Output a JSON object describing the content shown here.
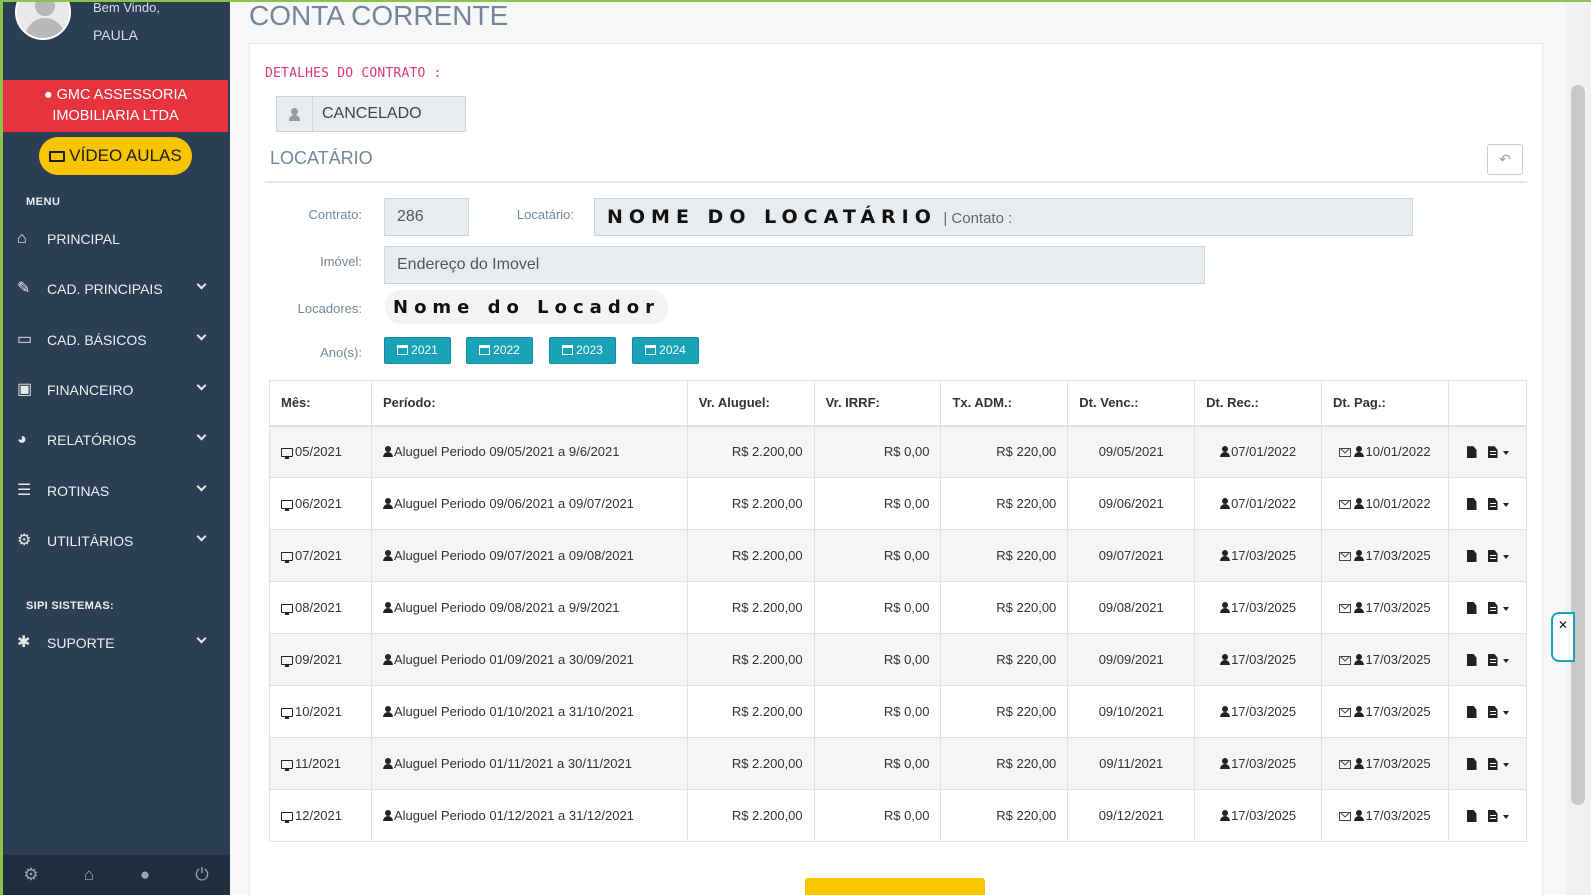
{
  "sidebar": {
    "welcome": "Bem Vindo,",
    "username": "PAULA",
    "company": "GMC ASSESSORIA IMOBILIARIA LTDA",
    "video_label": "VÍDEO AULAS",
    "menu_title": "MENU",
    "items": [
      {
        "label": "PRINCIPAL",
        "icon": "home-icon"
      },
      {
        "label": "CAD. PRINCIPAIS",
        "icon": "edit-icon"
      },
      {
        "label": "CAD. BÁSICOS",
        "icon": "folder-icon"
      },
      {
        "label": "FINANCEIRO",
        "icon": "money-icon"
      },
      {
        "label": "RELATÓRIOS",
        "icon": "pie-chart-icon"
      },
      {
        "label": "ROTINAS",
        "icon": "database-icon"
      },
      {
        "label": "UTILITÁRIOS",
        "icon": "gear-icon"
      }
    ],
    "section2_title": "SIPI SISTEMAS:",
    "support_label": "SUPORTE"
  },
  "page": {
    "title": "CONTA CORRENTE",
    "details_title": "DETALHES DO CONTRATO :",
    "status": "CANCELADO",
    "section_title": "LOCATÁRIO"
  },
  "form": {
    "contrato_label": "Contrato:",
    "contrato_value": "286",
    "locatario_label": "Locatário:",
    "locatario_value": "NOME DO LOCATÁRIO",
    "contato_label": "| Contato :",
    "imovel_label": "Imóvel:",
    "imovel_value": "Endereço do Imovel",
    "locadores_label": "Locadores:",
    "locadores_value": "Nome do Locador",
    "anos_label": "Ano(s):",
    "years": [
      "2021",
      "2022",
      "2023",
      "2024"
    ]
  },
  "table": {
    "headers": [
      "Mês:",
      "Período:",
      "Vr. Aluguel:",
      "Vr. IRRF:",
      "Tx. ADM.:",
      "Dt. Venc.:",
      "Dt. Rec.:",
      "Dt. Pag.:",
      ""
    ],
    "rows": [
      [
        "05/2021",
        "Aluguel Periodo 09/05/2021 a 9/6/2021",
        "R$ 2.200,00",
        "R$ 0,00",
        "R$ 220,00",
        "09/05/2021",
        "07/01/2022",
        "10/01/2022"
      ],
      [
        "06/2021",
        "Aluguel Periodo 09/06/2021 a 09/07/2021",
        "R$ 2.200,00",
        "R$ 0,00",
        "R$ 220,00",
        "09/06/2021",
        "07/01/2022",
        "10/01/2022"
      ],
      [
        "07/2021",
        "Aluguel Periodo 09/07/2021 a 09/08/2021",
        "R$ 2.200,00",
        "R$ 0,00",
        "R$ 220,00",
        "09/07/2021",
        "17/03/2025",
        "17/03/2025"
      ],
      [
        "08/2021",
        "Aluguel Periodo 09/08/2021 a 9/9/2021",
        "R$ 2.200,00",
        "R$ 0,00",
        "R$ 220,00",
        "09/08/2021",
        "17/03/2025",
        "17/03/2025"
      ],
      [
        "09/2021",
        "Aluguel Periodo 01/09/2021 a 30/09/2021",
        "R$ 2.200,00",
        "R$ 0,00",
        "R$ 220,00",
        "09/09/2021",
        "17/03/2025",
        "17/03/2025"
      ],
      [
        "10/2021",
        "Aluguel Periodo 01/10/2021 a 31/10/2021",
        "R$ 2.200,00",
        "R$ 0,00",
        "R$ 220,00",
        "09/10/2021",
        "17/03/2025",
        "17/03/2025"
      ],
      [
        "11/2021",
        "Aluguel Periodo 01/11/2021 a 30/11/2021",
        "R$ 2.200,00",
        "R$ 0,00",
        "R$ 220,00",
        "09/11/2021",
        "17/03/2025",
        "17/03/2025"
      ],
      [
        "12/2021",
        "Aluguel Periodo 01/12/2021 a 31/12/2021",
        "R$ 2.200,00",
        "R$ 0,00",
        "R$ 220,00",
        "09/12/2021",
        "17/03/2025",
        "17/03/2025"
      ]
    ]
  },
  "colors": {
    "sidebar_bg": "#2a3f54",
    "company_bg": "#e7333d",
    "video_bg": "#f9c500",
    "year_btn_bg": "#1aa3b8",
    "details_title": "#e03a6a"
  }
}
